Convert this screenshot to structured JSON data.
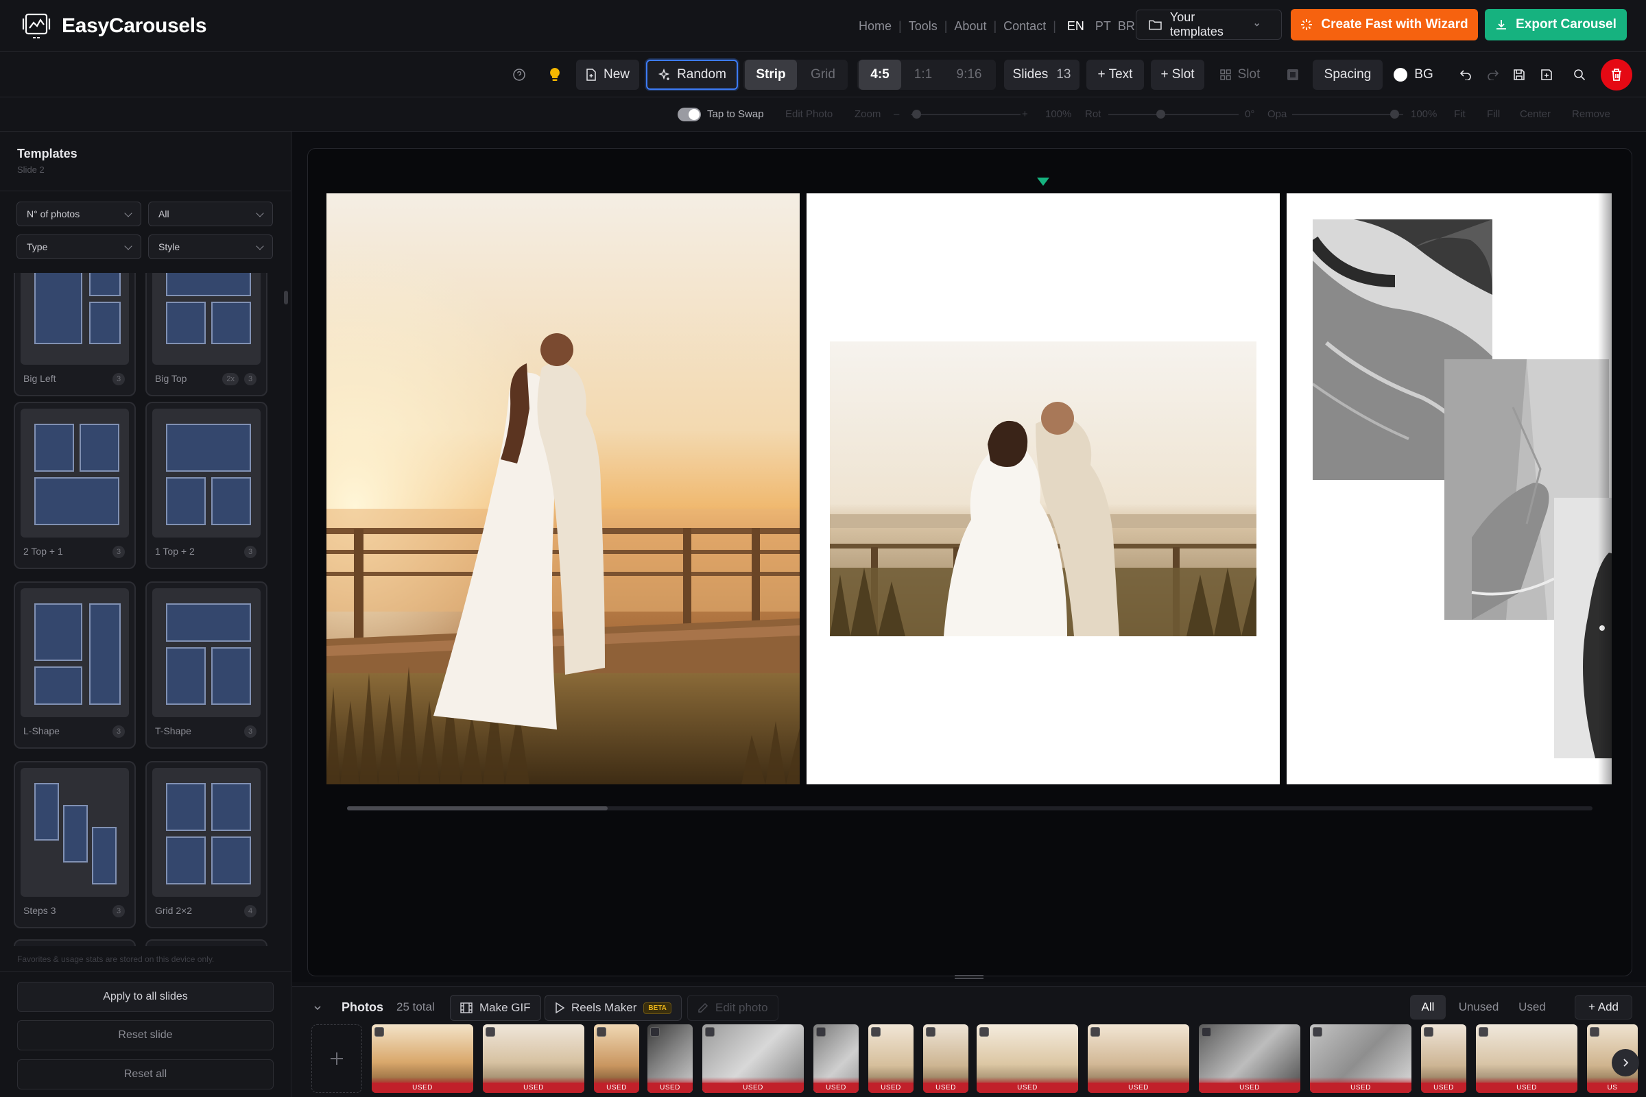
{
  "brand": {
    "name": "EasyCarousels"
  },
  "nav": {
    "links": [
      "Home",
      "Tools",
      "About",
      "Contact"
    ],
    "languages": [
      "EN",
      "PT",
      "BR"
    ],
    "your_templates": "Your templates",
    "wizard": "Create Fast with Wizard",
    "export": "Export Carousel"
  },
  "toolbar": {
    "new": "New",
    "random": "Random",
    "strip": "Strip",
    "grid": "Grid",
    "ratio_4_5": "4:5",
    "ratio_1_1": "1:1",
    "ratio_9_16": "9:16",
    "slides_label": "Slides",
    "slides_count": "13",
    "add_text": "+ Text",
    "add_slot": "+ Slot",
    "slot": "Slot",
    "spacing": "Spacing",
    "bg": "BG"
  },
  "controls": {
    "tap_to_swap": "Tap to Swap",
    "edit_photo": "Edit Photo",
    "zoom": "Zoom",
    "zoom_minus": "–",
    "zoom_plus": "+",
    "zoom_value": "100%",
    "rot": "Rot",
    "rot_value": "0°",
    "opa": "Opa",
    "opa_value": "100%",
    "fit": "Fit",
    "fill": "Fill",
    "center": "Center",
    "remove": "Remove"
  },
  "sidebar": {
    "title": "Templates",
    "subtitle": "Slide 2",
    "filters": {
      "photos": "N° of photos",
      "all": "All",
      "type": "Type",
      "style": "Style"
    },
    "templates": [
      {
        "label": "Big Left",
        "count": "3"
      },
      {
        "label": "Big Top",
        "count": "3",
        "extra": "2x"
      },
      {
        "label": "2 Top + 1",
        "count": "3"
      },
      {
        "label": "1 Top + 2",
        "count": "3"
      },
      {
        "label": "L-Shape",
        "count": "3"
      },
      {
        "label": "T-Shape",
        "count": "3"
      },
      {
        "label": "Steps 3",
        "count": "3"
      },
      {
        "label": "Grid 2×2",
        "count": "4"
      }
    ],
    "note": "Favorites & usage stats are stored on this device only.",
    "apply_all": "Apply to all slides",
    "reset_slide": "Reset slide",
    "reset_all": "Reset all"
  },
  "photos": {
    "label": "Photos",
    "total": "25 total",
    "make_gif": "Make GIF",
    "reels_maker": "Reels Maker",
    "beta": "BETA",
    "edit_photo": "Edit photo",
    "filters": [
      "All",
      "Unused",
      "Used"
    ],
    "add": "+ Add",
    "used_tag": "USED",
    "used_badge": "US"
  },
  "colors": {
    "accent_orange": "#f6620f",
    "accent_green": "#16b27f",
    "focus_blue": "#3d7bf5",
    "danger": "#e50914"
  }
}
